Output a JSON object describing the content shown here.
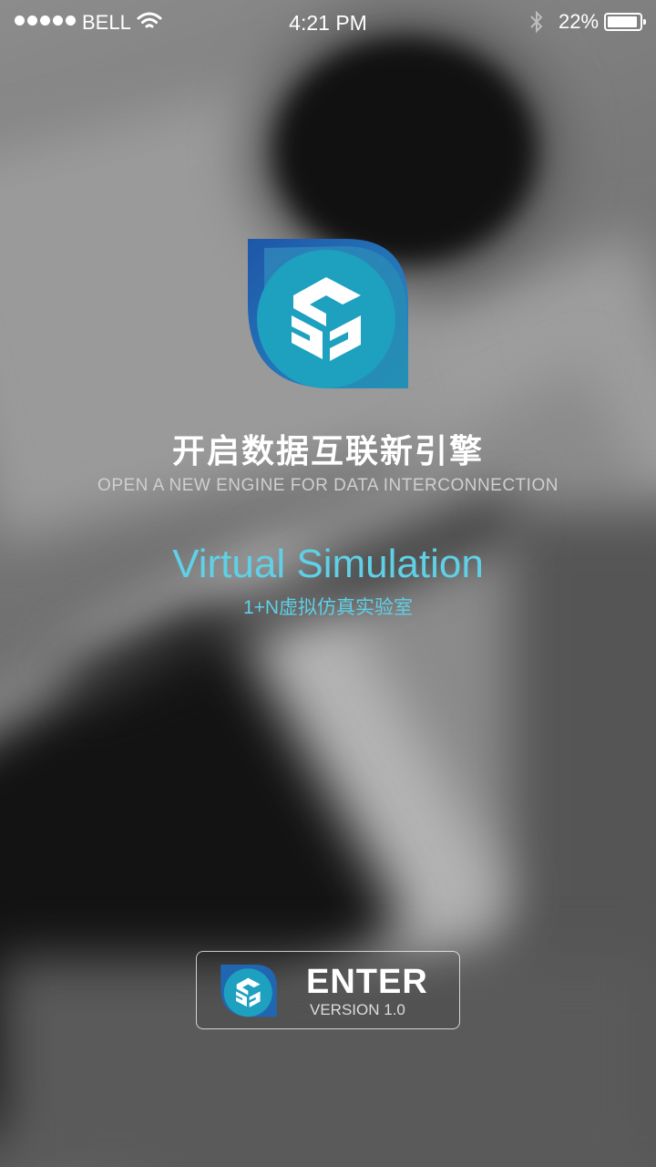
{
  "status_bar": {
    "carrier": "BELL",
    "time": "4:21 PM",
    "battery_percent": "22%",
    "battery_level": 0.22,
    "signal_bars": 5
  },
  "logo_icon": "cube-logo-icon",
  "headline": {
    "title_cn": "开启数据互联新引擎",
    "subtitle_en": "OPEN A NEW ENGINE FOR DATA INTERCONNECTION"
  },
  "product": {
    "name": "Virtual Simulation",
    "tagline": "1+N虚拟仿真实验室"
  },
  "enter_button": {
    "label": "ENTER",
    "version": "VERSION 1.0"
  },
  "colors": {
    "accent": "#5fd0e6",
    "logo_dark": "#1f5fae",
    "logo_light": "#1f9fc0"
  }
}
